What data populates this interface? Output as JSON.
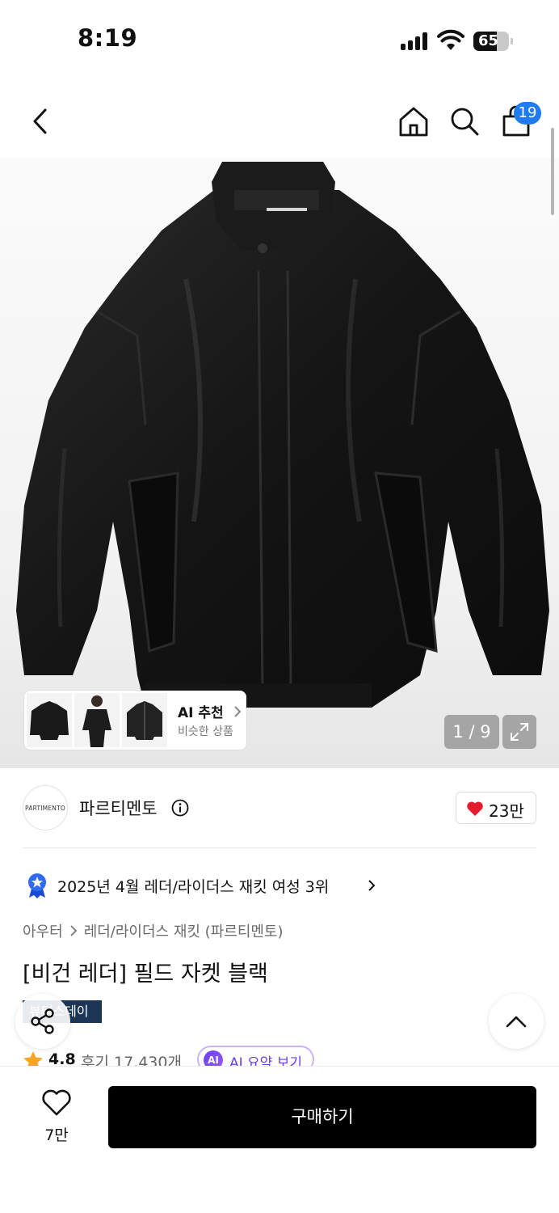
{
  "status_bar": {
    "time": "8:19",
    "battery": "65",
    "battery_level": 0.65
  },
  "top_nav": {
    "back_icon": "chevron-left-icon",
    "home_icon": "home-icon",
    "search_icon": "search-icon",
    "cart_icon": "shopping-bag-icon",
    "cart_count": "19",
    "badge_color": "#1f7cf0"
  },
  "gallery": {
    "image": "black-leather-jacket",
    "counter": "1 / 9",
    "expand_icon": "expand-icon",
    "ai_recommend": {
      "title": "AI 추천",
      "subtitle": "비슷한 상품"
    }
  },
  "brand": {
    "logo_text": "PARTIMENTO",
    "name": "파르티멘토",
    "like_count": "23만",
    "heart_color": "#e31b2c"
  },
  "ranking": {
    "text": "2025년 4월 레더/라이더스 재킷 여성 3위"
  },
  "breadcrumb": {
    "category": "아우터",
    "subcategory": "레더/라이더스 재킷 (파르티멘토)"
  },
  "product": {
    "title": "[비건 레더] 필드 자켓 블랙",
    "event_badge": "뷰티스데이",
    "rating": "4.8",
    "reviews": "후기 17,430개",
    "ai_summary_icon": "AI",
    "ai_summary_label": "AI 요약 보기"
  },
  "bottom_bar": {
    "wish_count": "7만",
    "buy_label": "구매하기"
  },
  "colors": {
    "accent": "#1f7cf0",
    "ai_purple": "#6a3ef0",
    "event_navy": "#1c3557"
  }
}
